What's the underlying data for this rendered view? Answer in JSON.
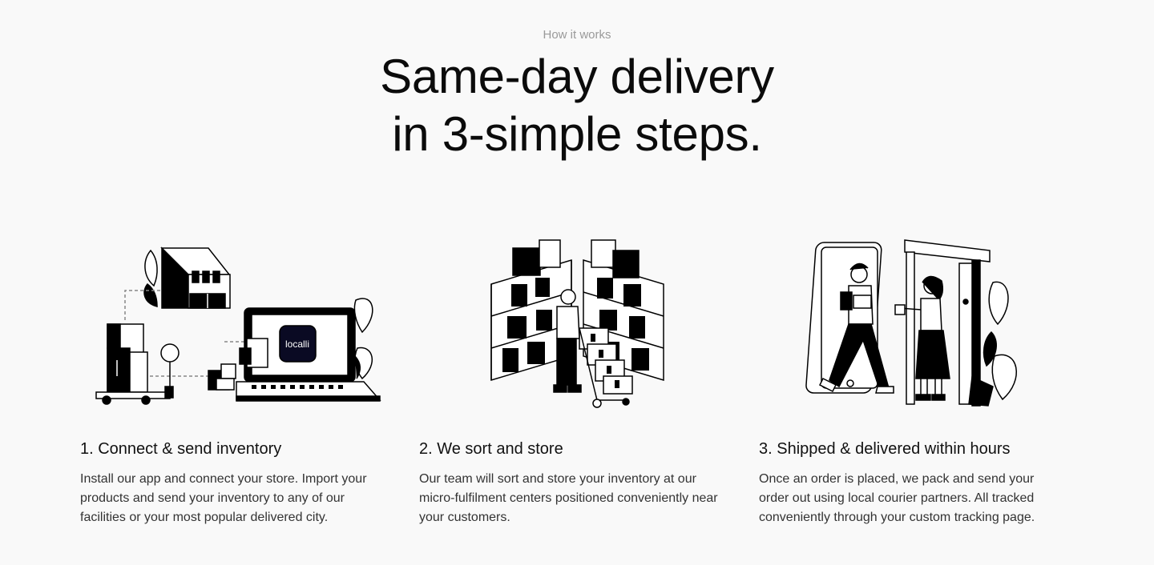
{
  "section": {
    "eyebrow": "How it works",
    "headline_line1": "Same-day delivery",
    "headline_line2": "in 3-simple steps."
  },
  "steps": [
    {
      "title": "1. Connect & send inventory",
      "description": "Install our app and connect your store. Import your products and send your inventory to any of our facilities or your most popular delivered city.",
      "illustration": "store-laptop-illustration",
      "logo_text": "localli"
    },
    {
      "title": "2. We sort and store",
      "description": "Our team will sort and store your inventory at our micro-fulfilment centers positioned conveniently near your customers.",
      "illustration": "warehouse-shelves-illustration"
    },
    {
      "title": "3. Shipped & delivered within hours",
      "description": "Once an order is placed, we pack and send your order out using local courier partners. All tracked conveniently through your custom tracking page.",
      "illustration": "courier-delivery-illustration"
    }
  ]
}
